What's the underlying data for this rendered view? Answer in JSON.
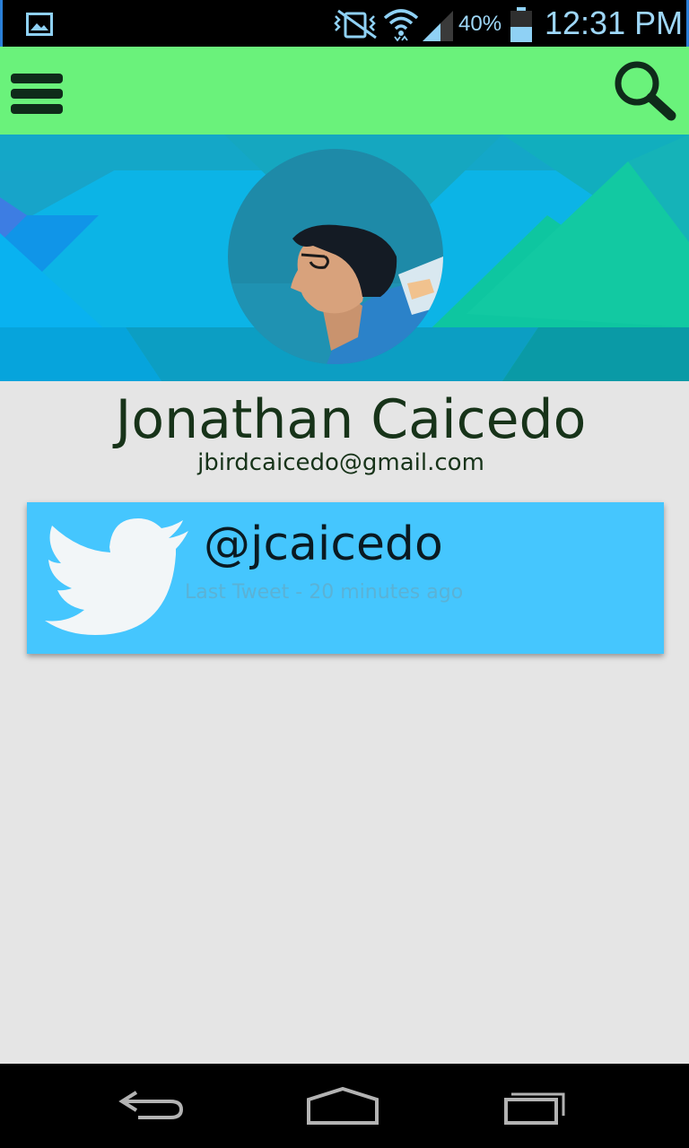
{
  "status_bar": {
    "battery_percent": "40%",
    "time": "12:31 PM",
    "icons": [
      "gallery-icon",
      "vibrate-mute-icon",
      "wifi-icon",
      "signal-icon",
      "battery-icon"
    ],
    "accent_color": "#8fd1f5"
  },
  "app_bar": {
    "background_color": "#6af27b",
    "icons": [
      "menu-icon",
      "search-icon"
    ]
  },
  "profile": {
    "name": "Jonathan Caicedo",
    "email": "jbirdcaicedo@gmail.com"
  },
  "twitter_card": {
    "handle": "@jcaicedo",
    "last_tweet": "Last Tweet - 20 minutes ago",
    "background_color": "#45c6fe",
    "icon": "twitter-bird-icon"
  },
  "nav_bar": {
    "icons": [
      "back-icon",
      "home-icon",
      "recent-apps-icon"
    ]
  }
}
